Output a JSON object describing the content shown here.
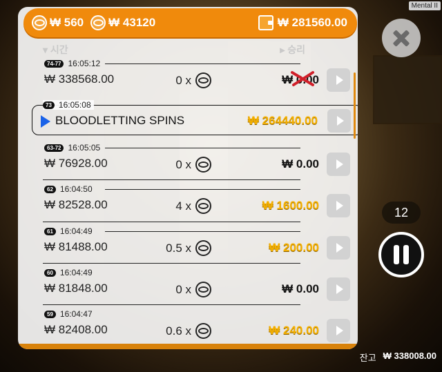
{
  "game_tag": "Mental II",
  "header": {
    "coin_balance_1": "₩ 560",
    "coin_balance_2": "₩ 43120",
    "wallet_total": "₩ 281560.00"
  },
  "columns": {
    "time": "▾ 시간",
    "win": "▸ 승리"
  },
  "feature": {
    "badge": "73",
    "time": "16:05:08",
    "name": "BLOODLETTING SPINS",
    "win": "₩ 264440.00"
  },
  "rows": [
    {
      "badge": "74-77",
      "time": "16:05:12",
      "bet": "₩ 338568.00",
      "mult": "0 x",
      "win": "₩ 0.00",
      "gold": false,
      "crossed": true
    },
    {
      "badge": "63-72",
      "time": "16:05:05",
      "bet": "₩ 76928.00",
      "mult": "0 x",
      "win": "₩ 0.00",
      "gold": false,
      "crossed": false
    },
    {
      "badge": "62",
      "time": "16:04:50",
      "bet": "₩ 82528.00",
      "mult": "4 x",
      "win": "₩ 1600.00",
      "gold": true,
      "crossed": false
    },
    {
      "badge": "61",
      "time": "16:04:49",
      "bet": "₩ 81488.00",
      "mult": "0.5 x",
      "win": "₩ 200.00",
      "gold": true,
      "crossed": false
    },
    {
      "badge": "60",
      "time": "16:04:49",
      "bet": "₩ 81848.00",
      "mult": "0 x",
      "win": "₩ 0.00",
      "gold": false,
      "crossed": false
    },
    {
      "badge": "59",
      "time": "16:04:47",
      "bet": "₩ 82408.00",
      "mult": "0.6 x",
      "win": "₩ 240.00",
      "gold": true,
      "crossed": false
    }
  ],
  "controls": {
    "spin_count": "12"
  },
  "footer": {
    "balance_label": "잔고",
    "balance_value": "₩ 338008.00"
  },
  "colors": {
    "accent": "#f08a0c",
    "gold": "#f5b000",
    "feature_arrow": "#1a62e8"
  }
}
